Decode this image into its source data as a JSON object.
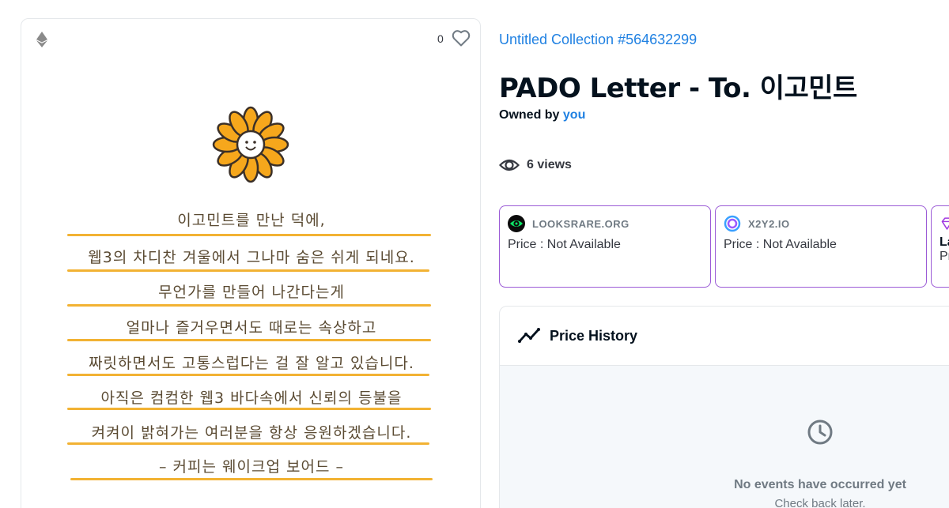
{
  "card": {
    "favorites_count": "0",
    "letter_lines": [
      "이고민트를 만난 덕에,",
      "웹3의 차디찬 겨울에서 그나마 숨은 쉬게 되네요.",
      "무언가를 만들어 나간다는게",
      "얼마나 즐거우면서도 때로는 속상하고",
      "짜릿하면서도 고통스럽다는 걸 잘 알고 있습니다.",
      "아직은 컴컴한 웹3 바다속에서 신뢰의 등불을",
      "켜켜이 밝혀가는 여러분을 항상 응원하겠습니다.",
      "– 커피는 웨이크업 보어드 –"
    ]
  },
  "collection_link": "Untitled Collection #564632299",
  "title": "PADO Letter - To. 이고민트",
  "owner": {
    "prefix": "Owned by",
    "name": "you"
  },
  "views": "6 views",
  "markets": [
    {
      "name": "LOOKSRARE.ORG",
      "price": "Price : Not Available",
      "icon": "looksrare-icon"
    },
    {
      "name": "X2Y2.IO",
      "price": "Price : Not Available",
      "icon": "x2y2-icon"
    },
    {
      "name": "La",
      "price": "Pr",
      "icon": "diamond-icon"
    }
  ],
  "price_history": {
    "title": "Price History",
    "empty_title": "No events have occurred yet",
    "empty_sub": "Check back later."
  },
  "colors": {
    "accent": "#2081e2",
    "market_border": "#9b5bd6",
    "underline": "#f2b233"
  }
}
